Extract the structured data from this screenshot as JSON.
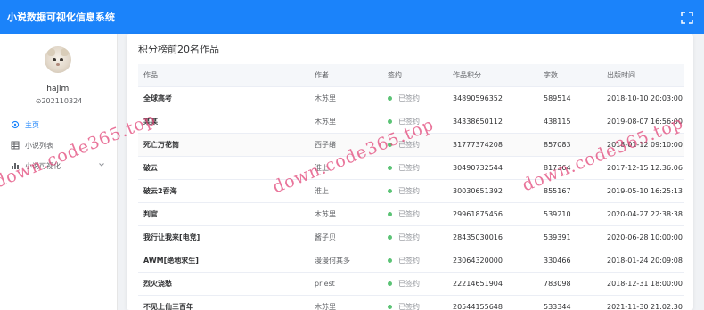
{
  "app": {
    "title": "小说数据可视化信息系统"
  },
  "user": {
    "name": "hajimi",
    "id": "⊙202110324"
  },
  "menu": {
    "home": "主页",
    "list": "小说列表",
    "viz": "小说可视化"
  },
  "card": {
    "title": "积分榜前20名作品"
  },
  "table": {
    "headers": {
      "title": "作品",
      "author": "作者",
      "sign": "签约",
      "score": "作品积分",
      "words": "字数",
      "time": "出版时间"
    },
    "rows": [
      {
        "title": "全球高考",
        "author": "木苏里",
        "sign": "已签约",
        "score": "34890596352",
        "words": "589514",
        "time": "2018-10-10 20:03:00"
      },
      {
        "title": "某某",
        "author": "木苏里",
        "sign": "已签约",
        "score": "34338650112",
        "words": "438115",
        "time": "2019-08-07 16:56:00"
      },
      {
        "title": "死亡万花筒",
        "author": "西子绪",
        "sign": "已签约",
        "score": "31777374208",
        "words": "857083",
        "time": "2018-01-12 09:10:00"
      },
      {
        "title": "破云",
        "author": "淮上",
        "sign": "已签约",
        "score": "30490732544",
        "words": "817364",
        "time": "2017-12-15 12:36:06"
      },
      {
        "title": "破云2吞海",
        "author": "淮上",
        "sign": "已签约",
        "score": "30030651392",
        "words": "855167",
        "time": "2019-05-10 16:25:13"
      },
      {
        "title": "判官",
        "author": "木苏里",
        "sign": "已签约",
        "score": "29961875456",
        "words": "539210",
        "time": "2020-04-27 22:38:38"
      },
      {
        "title": "我行让我来[电竞]",
        "author": "酱子贝",
        "sign": "已签约",
        "score": "28435030016",
        "words": "539391",
        "time": "2020-06-28 10:00:00"
      },
      {
        "title": "AWM[绝地求生]",
        "author": "漫漫何其多",
        "sign": "已签约",
        "score": "23064320000",
        "words": "330466",
        "time": "2018-01-24 20:09:08"
      },
      {
        "title": "烈火浇愁",
        "author": "priest",
        "sign": "已签约",
        "score": "22214651904",
        "words": "783098",
        "time": "2018-12-31 18:00:00"
      },
      {
        "title": "不见上仙三百年",
        "author": "木苏里",
        "sign": "已签约",
        "score": "20544155648",
        "words": "533344",
        "time": "2021-11-30 21:02:30"
      }
    ]
  },
  "watermark": "down.code365.top",
  "colors": {
    "header": "#1b83fa",
    "accent": "#1b83fa",
    "signed_dot": "#5bc375",
    "watermark": "#e14678"
  },
  "icons": {
    "fullscreen": "fullscreen-icon",
    "home": "home-icon",
    "list": "grid-list-icon",
    "viz": "bar-chart-icon",
    "chevron": "chevron-down-icon"
  }
}
